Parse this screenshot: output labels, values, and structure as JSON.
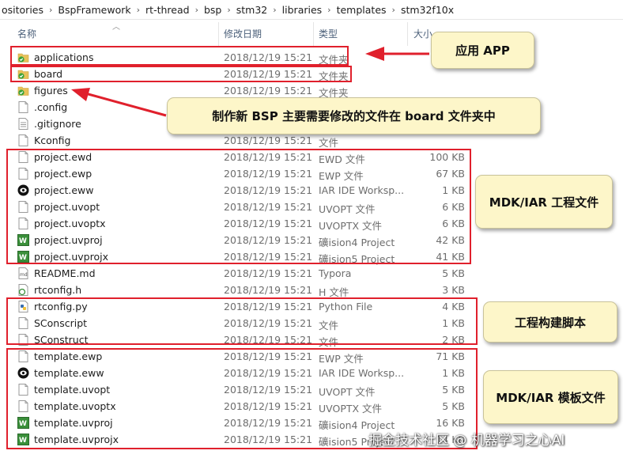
{
  "breadcrumb": [
    "ositories",
    "BspFramework",
    "rt-thread",
    "bsp",
    "stm32",
    "libraries",
    "templates",
    "stm32f10x"
  ],
  "columns": {
    "name": "名称",
    "date": "修改日期",
    "type": "类型",
    "size": "大小"
  },
  "files": [
    {
      "name": "applications",
      "date": "2018/12/19 15:21",
      "type": "文件夹",
      "size": "",
      "icon": "folder-check-icon"
    },
    {
      "name": "board",
      "date": "2018/12/19 15:21",
      "type": "文件夹",
      "size": "",
      "icon": "folder-check-icon"
    },
    {
      "name": "figures",
      "date": "2018/12/19 15:21",
      "type": "文件夹",
      "size": "",
      "icon": "folder-check-icon"
    },
    {
      "name": ".config",
      "date": "",
      "type": "",
      "size": "",
      "icon": "file-icon"
    },
    {
      "name": ".gitignore",
      "date": "",
      "type": "",
      "size": "",
      "icon": "text-file-icon"
    },
    {
      "name": "Kconfig",
      "date": "2018/12/19 15:21",
      "type": "文件",
      "size": "",
      "icon": "file-icon"
    },
    {
      "name": "project.ewd",
      "date": "2018/12/19 15:21",
      "type": "EWD 文件",
      "size": "100 KB",
      "icon": "file-icon"
    },
    {
      "name": "project.ewp",
      "date": "2018/12/19 15:21",
      "type": "EWP 文件",
      "size": "67 KB",
      "icon": "file-icon"
    },
    {
      "name": "project.eww",
      "date": "2018/12/19 15:21",
      "type": "IAR IDE Worksp...",
      "size": "1 KB",
      "icon": "iar-workspace-icon"
    },
    {
      "name": "project.uvopt",
      "date": "2018/12/19 15:21",
      "type": "UVOPT 文件",
      "size": "6 KB",
      "icon": "file-icon"
    },
    {
      "name": "project.uvoptx",
      "date": "2018/12/19 15:21",
      "type": "UVOPTX 文件",
      "size": "6 KB",
      "icon": "file-icon"
    },
    {
      "name": "project.uvproj",
      "date": "2018/12/19 15:21",
      "type": "礦ision4 Project",
      "size": "42 KB",
      "icon": "keil-project-icon"
    },
    {
      "name": "project.uvprojx",
      "date": "2018/12/19 15:21",
      "type": "礦ision5 Project",
      "size": "41 KB",
      "icon": "keil-project-icon"
    },
    {
      "name": "README.md",
      "date": "2018/12/19 15:21",
      "type": "Typora",
      "size": "5 KB",
      "icon": "markdown-icon"
    },
    {
      "name": "rtconfig.h",
      "date": "2018/12/19 15:21",
      "type": "H 文件",
      "size": "3 KB",
      "icon": "h-file-icon"
    },
    {
      "name": "rtconfig.py",
      "date": "2018/12/19 15:21",
      "type": "Python File",
      "size": "4 KB",
      "icon": "python-icon"
    },
    {
      "name": "SConscript",
      "date": "2018/12/19 15:21",
      "type": "文件",
      "size": "1 KB",
      "icon": "file-icon"
    },
    {
      "name": "SConstruct",
      "date": "2018/12/19 15:21",
      "type": "文件",
      "size": "2 KB",
      "icon": "file-icon"
    },
    {
      "name": "template.ewp",
      "date": "2018/12/19 15:21",
      "type": "EWP 文件",
      "size": "71 KB",
      "icon": "file-icon"
    },
    {
      "name": "template.eww",
      "date": "2018/12/19 15:21",
      "type": "IAR IDE Worksp...",
      "size": "1 KB",
      "icon": "iar-workspace-icon"
    },
    {
      "name": "template.uvopt",
      "date": "2018/12/19 15:21",
      "type": "UVOPT 文件",
      "size": "5 KB",
      "icon": "file-icon"
    },
    {
      "name": "template.uvoptx",
      "date": "2018/12/19 15:21",
      "type": "UVOPTX 文件",
      "size": "5 KB",
      "icon": "file-icon"
    },
    {
      "name": "template.uvproj",
      "date": "2018/12/19 15:21",
      "type": "礦ision4 Project",
      "size": "16 KB",
      "icon": "keil-project-icon"
    },
    {
      "name": "template.uvprojx",
      "date": "2018/12/19 15:21",
      "type": "礦ision5 Project",
      "size": "14 KB",
      "icon": "keil-project-icon"
    }
  ],
  "callouts": {
    "app": "应用 APP",
    "board": "制作新 BSP 主要需要修改的文件在 board 文件夹中",
    "project": "MDK/IAR 工程文件",
    "build": "工程构建脚本",
    "template": "MDK/IAR 模板文件"
  },
  "watermark": "掘金技术社区 @ 机器学习之心AI",
  "colors": {
    "highlight_box": "#e0202c",
    "callout_bg": "#fdf6c9",
    "folder": "#e8c15a",
    "check": "#3aa33a",
    "header_text": "#4c607a"
  }
}
